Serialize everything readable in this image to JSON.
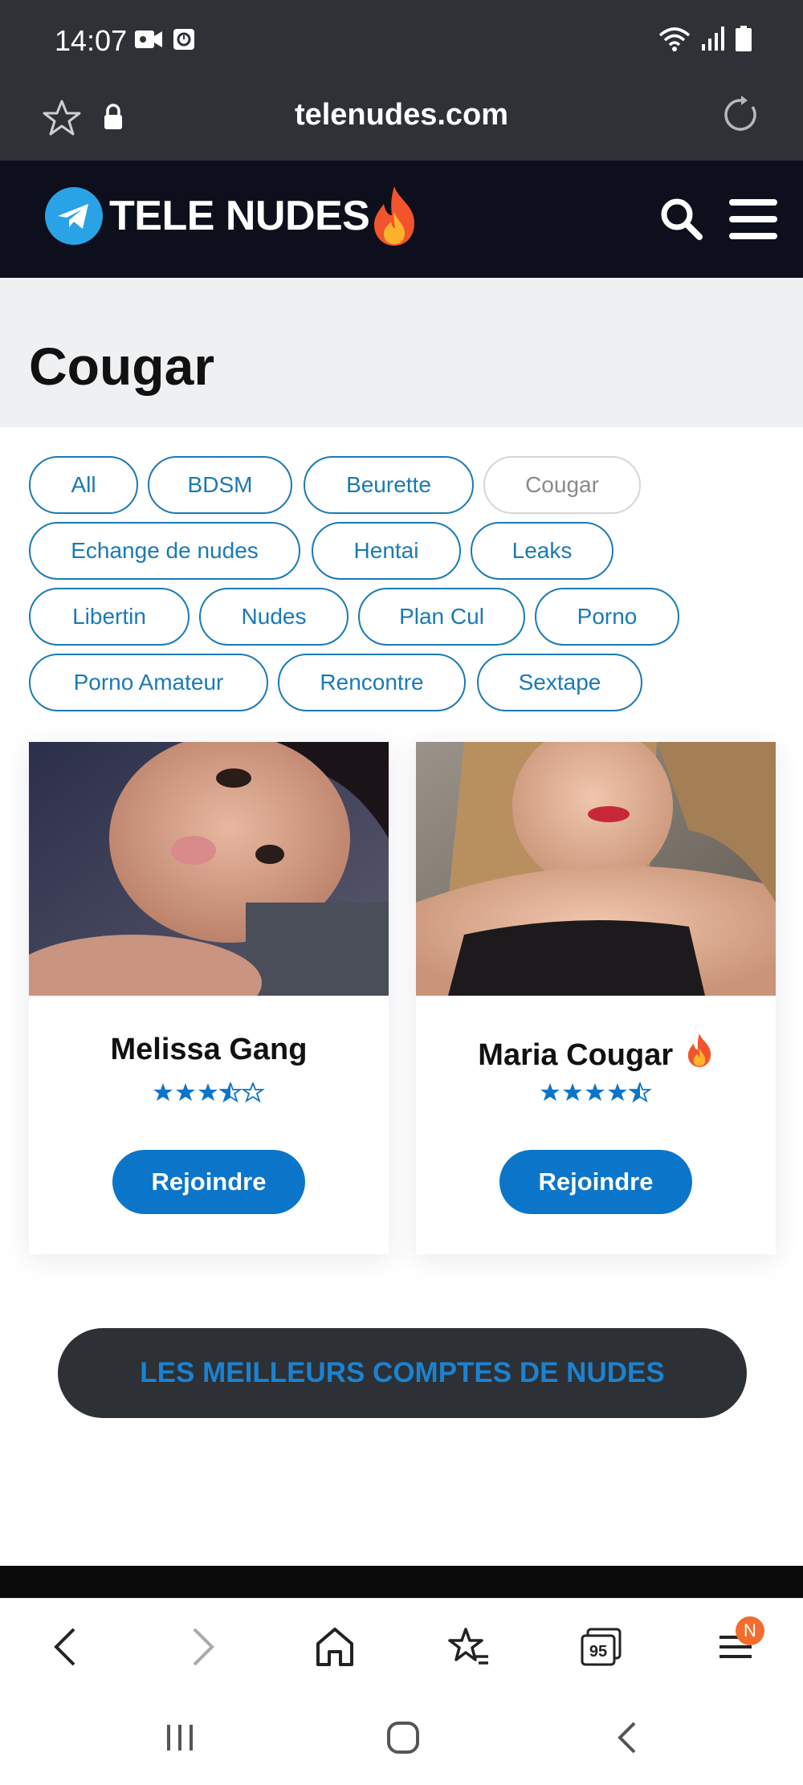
{
  "status_bar": {
    "time": "14:07"
  },
  "browser": {
    "url": "telenudes.com"
  },
  "site": {
    "logo_text": "TELE NUDES"
  },
  "page": {
    "title": "Cougar"
  },
  "tags": [
    {
      "label": "All"
    },
    {
      "label": "BDSM"
    },
    {
      "label": "Beurette"
    },
    {
      "label": "Cougar",
      "active": true
    },
    {
      "label": "Echange de nudes"
    },
    {
      "label": "Hentai"
    },
    {
      "label": "Leaks"
    },
    {
      "label": "Libertin"
    },
    {
      "label": "Nudes"
    },
    {
      "label": "Plan Cul"
    },
    {
      "label": "Porno"
    },
    {
      "label": "Porno Amateur"
    },
    {
      "label": "Rencontre"
    },
    {
      "label": "Sextape"
    }
  ],
  "cards": [
    {
      "name": "Melissa Gang",
      "rating": 3.5,
      "button": "Rejoindre"
    },
    {
      "name": "Maria Cougar",
      "rating": 4.5,
      "button": "Rejoindre",
      "hot": true
    }
  ],
  "banner": {
    "label": "LES MEILLEURS COMPTES DE NUDES"
  },
  "bottom_bar": {
    "tabs_count": "95",
    "notification_badge": "N"
  },
  "colors": {
    "accent": "#0b75c9",
    "tag_border": "#1a7ab5",
    "header_bg": "#0d0f1c",
    "chrome_bg": "#2e3236",
    "badge": "#f26c2d"
  },
  "icons": [
    "star-icon",
    "lock-icon",
    "reload-icon",
    "telegram-icon",
    "fire-icon",
    "search-icon",
    "menu-icon",
    "back-icon",
    "forward-icon",
    "home-icon",
    "bookmarks-icon",
    "tabs-icon",
    "more-menu-icon",
    "recent-apps-icon",
    "home-button-icon",
    "system-back-icon"
  ]
}
